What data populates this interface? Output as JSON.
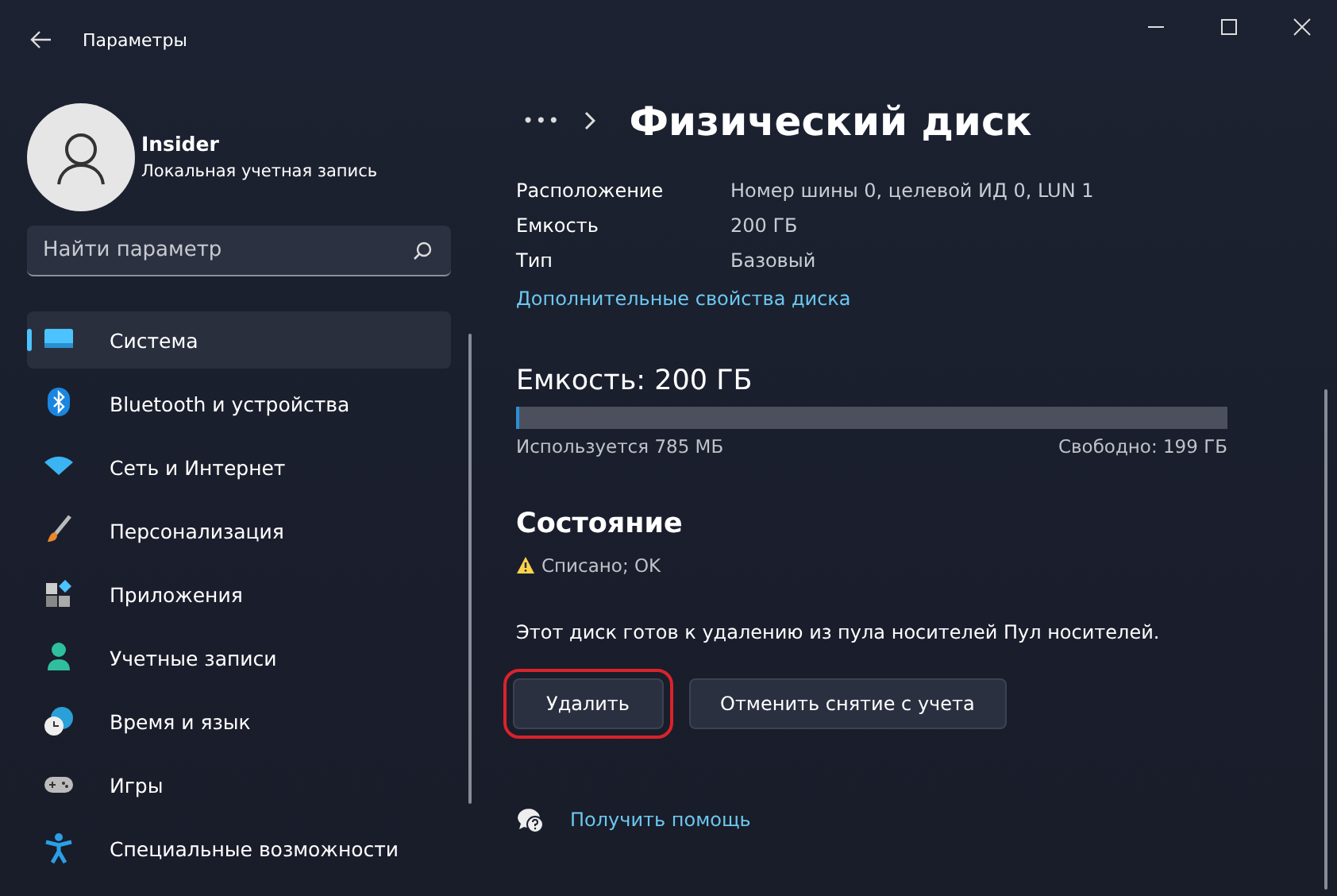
{
  "window": {
    "title": "Параметры"
  },
  "account": {
    "name": "Insider",
    "subtitle": "Локальная учетная запись"
  },
  "search": {
    "placeholder": "Найти параметр"
  },
  "nav": [
    {
      "label": "Система",
      "selected": true
    },
    {
      "label": "Bluetooth и устройства",
      "selected": false
    },
    {
      "label": "Сеть и Интернет",
      "selected": false
    },
    {
      "label": "Персонализация",
      "selected": false
    },
    {
      "label": "Приложения",
      "selected": false
    },
    {
      "label": "Учетные записи",
      "selected": false
    },
    {
      "label": "Время и язык",
      "selected": false
    },
    {
      "label": "Игры",
      "selected": false
    },
    {
      "label": "Специальные возможности",
      "selected": false
    }
  ],
  "breadcrumb": {
    "more": "•••",
    "title": "Физический диск"
  },
  "properties": [
    {
      "label": "Расположение",
      "value": "Номер шины 0, целевой ИД 0, LUN 1"
    },
    {
      "label": "Емкость",
      "value": "200 ГБ"
    },
    {
      "label": "Тип",
      "value": "Базовый"
    }
  ],
  "properties_link": "Дополнительные свойства диска",
  "capacity": {
    "heading": "Емкость: 200 ГБ",
    "level": 0.004,
    "used": "Используется 785 МБ",
    "free": "Свободно: 199 ГБ"
  },
  "status": {
    "heading": "Состояние",
    "kind": "warning",
    "text": "Списано; OK"
  },
  "description": "Этот диск готов к удалению из пула носителей Пул носителей.",
  "buttons": [
    {
      "label": "Удалить",
      "highlighted": true
    },
    {
      "label": "Отменить снятие с учета",
      "highlighted": false
    }
  ],
  "help": "Получить помощь"
}
